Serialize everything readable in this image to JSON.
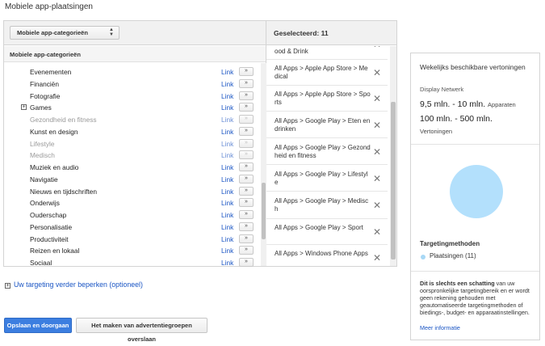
{
  "page": {
    "title": "Mobiele app-plaatsingen"
  },
  "left_panel": {
    "dropdown_label": "Mobiele app-categorieën",
    "header": "Mobiele app-categorieën",
    "link_label": "Link",
    "add_glyph": "»",
    "categories": [
      {
        "name": "Evenementen",
        "disabled": false,
        "expandable": false
      },
      {
        "name": "Financiën",
        "disabled": false,
        "expandable": false
      },
      {
        "name": "Fotografie",
        "disabled": false,
        "expandable": false
      },
      {
        "name": "Games",
        "disabled": false,
        "expandable": true
      },
      {
        "name": "Gezondheid en fitness",
        "disabled": true,
        "expandable": false
      },
      {
        "name": "Kunst en design",
        "disabled": false,
        "expandable": false
      },
      {
        "name": "Lifestyle",
        "disabled": true,
        "expandable": false
      },
      {
        "name": "Medisch",
        "disabled": true,
        "expandable": false
      },
      {
        "name": "Muziek en audio",
        "disabled": false,
        "expandable": false
      },
      {
        "name": "Navigatie",
        "disabled": false,
        "expandable": false
      },
      {
        "name": "Nieuws en tijdschriften",
        "disabled": false,
        "expandable": false
      },
      {
        "name": "Onderwijs",
        "disabled": false,
        "expandable": false
      },
      {
        "name": "Ouderschap",
        "disabled": false,
        "expandable": false
      },
      {
        "name": "Personalisatie",
        "disabled": false,
        "expandable": false
      },
      {
        "name": "Productiviteit",
        "disabled": false,
        "expandable": false
      },
      {
        "name": "Reizen en lokaal",
        "disabled": false,
        "expandable": false
      },
      {
        "name": "Sociaal",
        "disabled": false,
        "expandable": false
      }
    ]
  },
  "selected_panel": {
    "header": "Geselecteerd: 11",
    "remove_glyph": "✕",
    "items": [
      {
        "text": "ood & Drink"
      },
      {
        "text": "All Apps > Apple App Store > Medical"
      },
      {
        "text": "All Apps > Apple App Store > Sports"
      },
      {
        "text": "All Apps > Google Play > Eten en drinken"
      },
      {
        "text": "All Apps > Google Play > Gezondheid en fitness"
      },
      {
        "text": "All Apps > Google Play > Lifestyle"
      },
      {
        "text": "All Apps > Google Play > Medisch"
      },
      {
        "text": "All Apps > Google Play > Sport"
      },
      {
        "text": "All Apps > Windows Phone Apps"
      }
    ]
  },
  "info_panel": {
    "title": "Wekelijks beschikbare vertoningen",
    "network": "Display Netwerk",
    "devices_range": "9,5 mln. - 10 mln.",
    "devices_unit": "Apparaten",
    "impressions_range": "100 mln. - 500 mln.",
    "impressions_unit": "Vertoningen",
    "methods_title": "Targetingmethoden",
    "legend_label": "Plaatsingen (11)",
    "note_bold": "Dit is slechts een schatting",
    "note_rest": " van uw oorspronkelijke targetingbereik en er wordt geen rekening gehouden met geautomatiseerde targetingmethoden of biedings-, budget- en apparaatinstellingen.",
    "more_link": "Meer informatie",
    "colors": {
      "circle": "#b3e0fc"
    }
  },
  "footer": {
    "refine_link": "Uw targeting verder beperken (optioneel)",
    "primary_button": "Opslaan en doorgaan",
    "secondary_button": "Het maken van advertentiegroepen overslaan"
  }
}
